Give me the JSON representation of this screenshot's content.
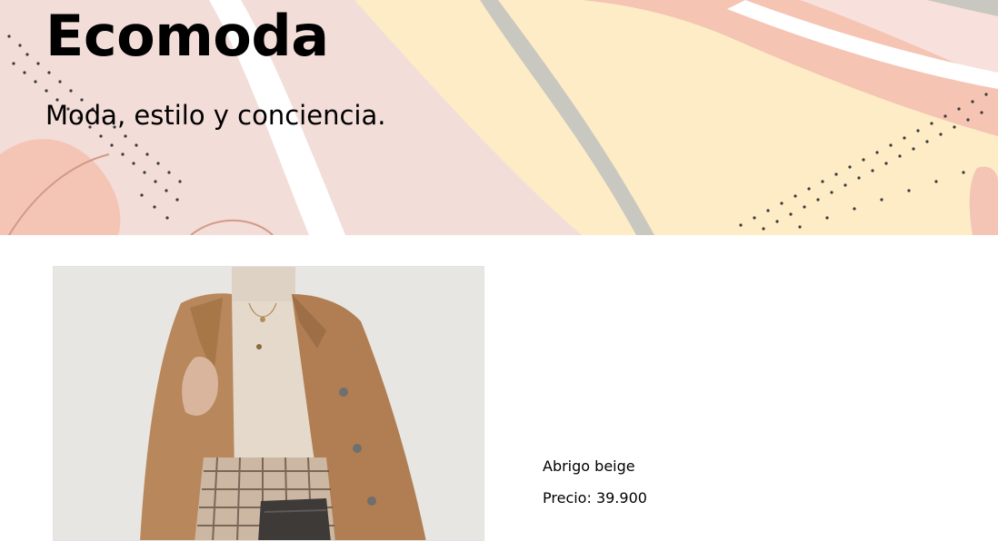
{
  "header": {
    "title_bold": "Eco",
    "title_rest": "moda",
    "tagline": "Moda, estilo y conciencia."
  },
  "product": {
    "image_alt": "Abrigo beige",
    "name": "Abrigo beige",
    "price_text": "Precio: 39.900"
  },
  "colors": {
    "hero_pink": "#f3ddd9",
    "hero_yellow": "#fdecc6",
    "hero_salmon": "#f5c4b3",
    "hero_grey": "#c9c8c0",
    "coat_camel": "#b8875c",
    "sweater_cream": "#e4d9cb"
  }
}
